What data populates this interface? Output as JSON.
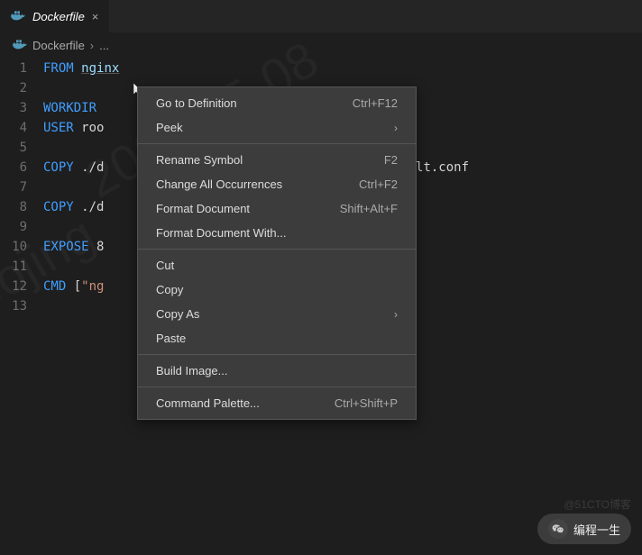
{
  "tab": {
    "filename": "Dockerfile"
  },
  "breadcrumb": {
    "filename": "Dockerfile",
    "sep": "›",
    "more": "..."
  },
  "watermark": {
    "text1": "2022-05-08",
    "text2": "bojing"
  },
  "lines": [
    {
      "n": "1",
      "kw": "FROM",
      "rest": " ",
      "val": "nginx"
    },
    {
      "n": "2",
      "kw": "",
      "rest": "",
      "val": ""
    },
    {
      "n": "3",
      "kw": "WORKDIR",
      "rest": " ",
      "val": ""
    },
    {
      "n": "4",
      "kw": "USER",
      "rest": " roo",
      "val": ""
    },
    {
      "n": "5",
      "kw": "",
      "rest": "",
      "val": ""
    },
    {
      "n": "6",
      "kw": "COPY",
      "rest": " ./d",
      "val": "",
      "tail": "                                      fault.conf"
    },
    {
      "n": "7",
      "kw": "",
      "rest": "",
      "val": ""
    },
    {
      "n": "8",
      "kw": "COPY",
      "rest": " ./d",
      "val": ""
    },
    {
      "n": "9",
      "kw": "",
      "rest": "",
      "val": ""
    },
    {
      "n": "10",
      "kw": "EXPOSE",
      "rest": " 8",
      "val": ""
    },
    {
      "n": "11",
      "kw": "",
      "rest": "",
      "val": ""
    },
    {
      "n": "12",
      "kw": "CMD",
      "rest": " [",
      "str": "\"ng"
    },
    {
      "n": "13",
      "kw": "",
      "rest": "",
      "val": ""
    }
  ],
  "menu": {
    "items": [
      {
        "label": "Go to Definition",
        "shortcut": "Ctrl+F12"
      },
      {
        "label": "Peek",
        "submenu": true
      },
      {
        "sep": true
      },
      {
        "label": "Rename Symbol",
        "shortcut": "F2"
      },
      {
        "label": "Change All Occurrences",
        "shortcut": "Ctrl+F2"
      },
      {
        "label": "Format Document",
        "shortcut": "Shift+Alt+F"
      },
      {
        "label": "Format Document With..."
      },
      {
        "sep": true
      },
      {
        "label": "Cut"
      },
      {
        "label": "Copy"
      },
      {
        "label": "Copy As",
        "submenu": true
      },
      {
        "label": "Paste"
      },
      {
        "sep": true
      },
      {
        "label": "Build Image..."
      },
      {
        "sep": true
      },
      {
        "label": "Command Palette...",
        "shortcut": "Ctrl+Shift+P"
      }
    ]
  },
  "badge": {
    "text": "编程一生"
  },
  "attrib": {
    "text": "@51CTO博客"
  }
}
